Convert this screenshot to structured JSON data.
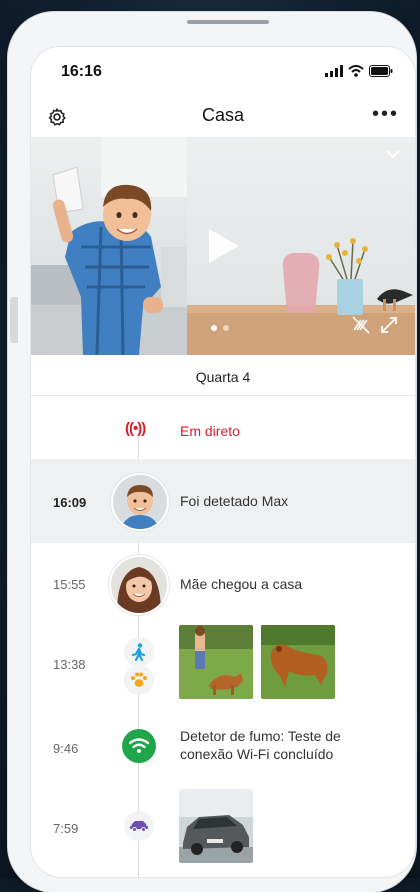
{
  "status": {
    "time": "16:16"
  },
  "header": {
    "title": "Casa",
    "more": "•••"
  },
  "timeline": {
    "date": "Quarta 4",
    "live": {
      "label": "Em direto"
    },
    "events": [
      {
        "time": "16:09",
        "label": "Foi detetado Max"
      },
      {
        "time": "15:55",
        "label": "Mãe chegou a casa"
      },
      {
        "time": "13:38",
        "label": ""
      },
      {
        "time": "9:46",
        "label_line1": "Detetor de fumo: Teste de",
        "label_line2": "conexão Wi-Fi concluído"
      },
      {
        "time": "7:59",
        "label": ""
      }
    ]
  },
  "colors": {
    "live": "#d61f26",
    "wifi": "#1fa64a",
    "motion": "#1aa3d9",
    "pet": "#f2a61a",
    "car": "#6e4fb3"
  }
}
